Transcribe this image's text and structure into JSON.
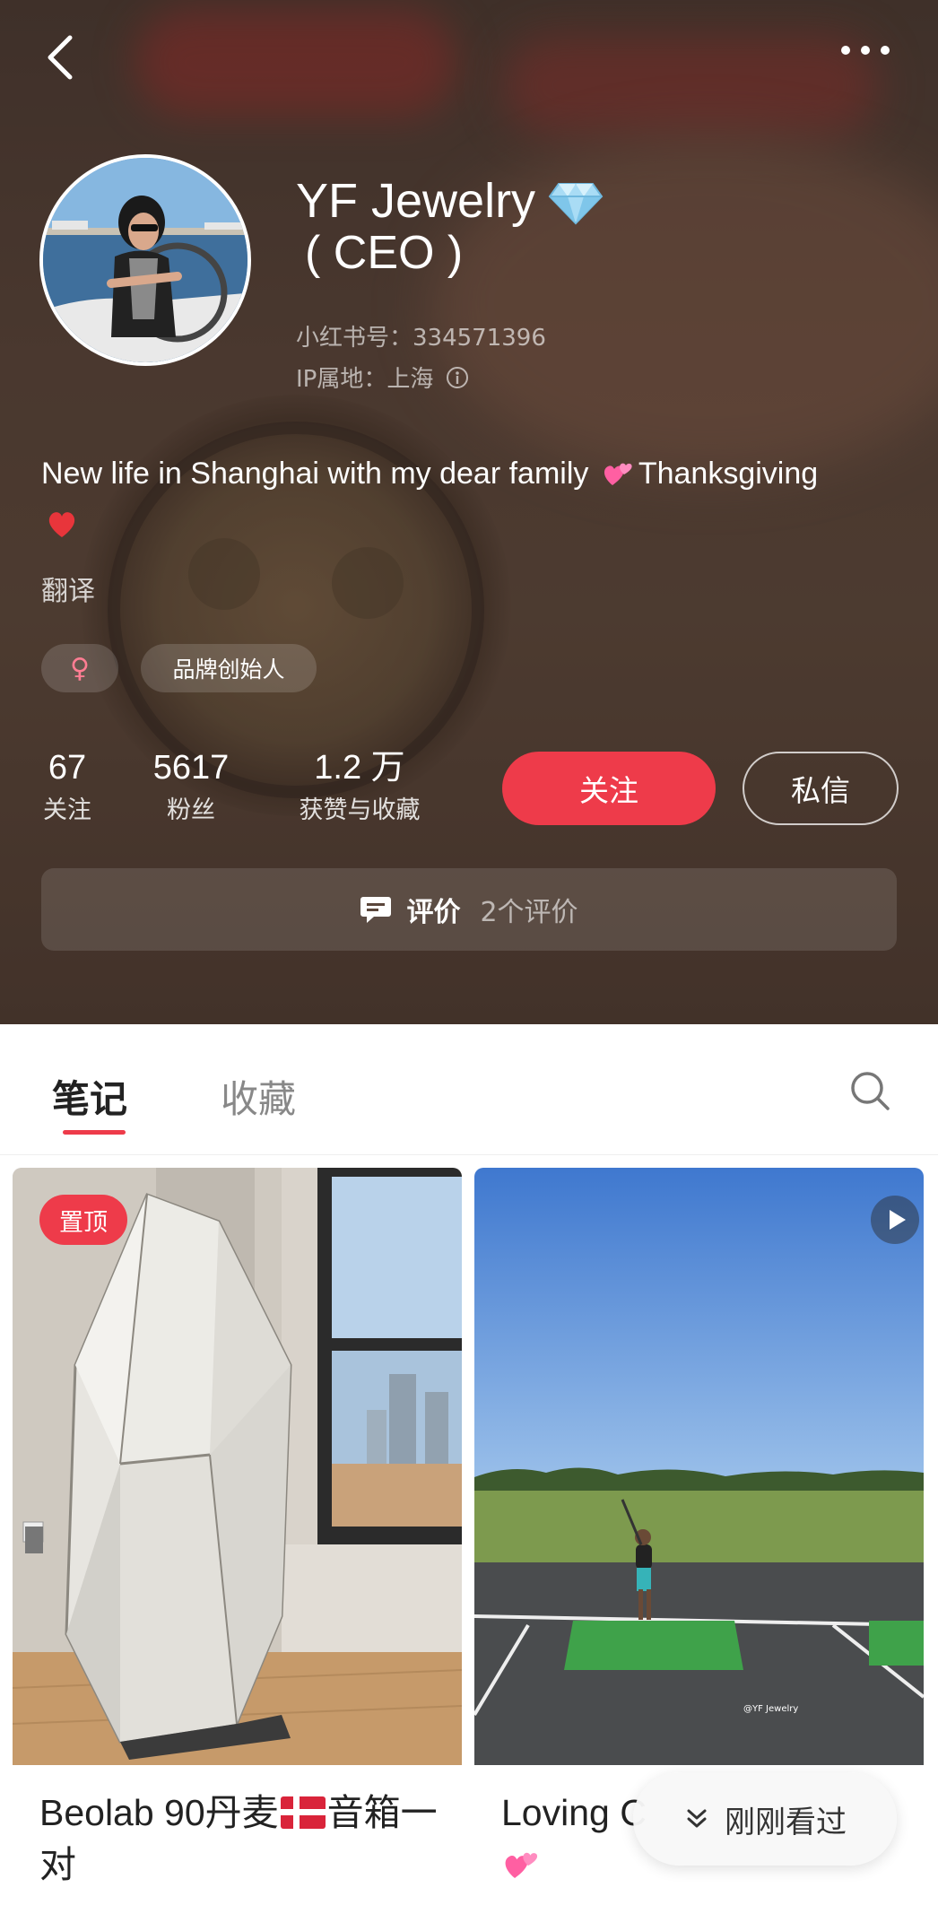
{
  "profile": {
    "name": "YF Jewelry",
    "name_suffix": "( CEO )",
    "red_id": "小红书号：334571396",
    "ip_location": "IP属地：上海",
    "bio": "New life in Shanghai with my dear family",
    "bio_tail": "Thanksgiving",
    "translate_label": "翻译",
    "gender_symbol": "♀",
    "tag_role": "品牌创始人"
  },
  "stats": [
    {
      "value": "67",
      "label": "关注"
    },
    {
      "value": "5617",
      "label": "粉丝"
    },
    {
      "value": "1.2 万",
      "label": "获赞与收藏"
    }
  ],
  "actions": {
    "follow_label": "关注",
    "message_label": "私信"
  },
  "reviews": {
    "label": "评价",
    "count_text": "2个评价"
  },
  "tabs": [
    {
      "label": "笔记",
      "active": true
    },
    {
      "label": "收藏",
      "active": false
    }
  ],
  "feed": {
    "cards": [
      {
        "badge": "置顶",
        "title_part1": "Beolab 90丹麦",
        "title_part2": "音箱一对",
        "media": "image"
      },
      {
        "title": "Loving C",
        "media": "video"
      }
    ],
    "recent_pill_label": "刚刚看过"
  },
  "icons": {
    "back": "chevron-left-icon",
    "more": "more-dots-icon",
    "diamond": "diamond-icon",
    "info": "info-icon",
    "review": "comment-icon",
    "search": "search-icon",
    "video": "play-icon",
    "recent": "chevrons-down-icon"
  },
  "colors": {
    "accent": "#ee3b4a",
    "header_bg": "#5a463b",
    "text_dark": "#222222",
    "text_muted": "#888888"
  }
}
